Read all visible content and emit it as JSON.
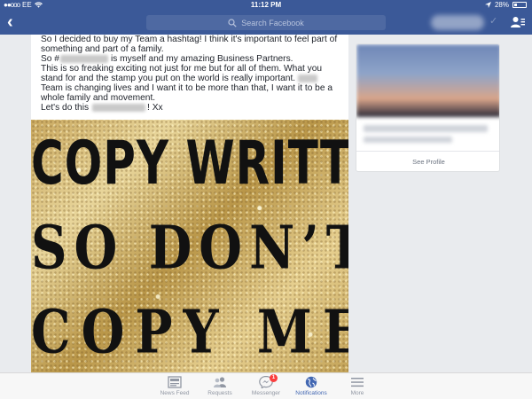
{
  "status_bar": {
    "carrier": "EE",
    "signal": "●●ooo",
    "time": "11:12 PM",
    "battery": "28%"
  },
  "nav": {
    "back_glyph": "‹",
    "search_placeholder": "Search Facebook"
  },
  "post": {
    "lines": [
      "So I decided to buy my Team a hashtag! I think it's important to feel part of",
      "something and part of a family.",
      "is myself and my amazing Business Partners.",
      "This is so freaking exciting not just for me but for all of them. What you",
      "stand for and the stamp you put on the world is really important.",
      "Team is changing lives and I want it to be more than that, I want it to be a",
      "whole family and movement.",
      "! Xx"
    ],
    "hash_prefix": "So #",
    "closing_prefix": "Let's do this"
  },
  "image_text": {
    "line1": "COPY WRITTEN",
    "line2": "SO DON’T",
    "line3": "COPY ME"
  },
  "profile_card": {
    "see_profile": "See Profile"
  },
  "tabbar": {
    "tabs": [
      {
        "label": "News Feed",
        "icon": "news-feed-icon"
      },
      {
        "label": "Requests",
        "icon": "friend-requests-icon"
      },
      {
        "label": "Messenger",
        "icon": "messenger-icon",
        "badge": "1"
      },
      {
        "label": "Notifications",
        "icon": "globe-icon",
        "active": true
      },
      {
        "label": "More",
        "icon": "menu-icon"
      }
    ]
  },
  "colors": {
    "brand": "#3b5998",
    "active_tab": "#4267b2",
    "badge": "#fa3e3e"
  }
}
